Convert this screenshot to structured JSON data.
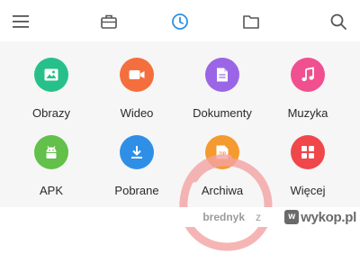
{
  "toolbar": {
    "items": [
      {
        "icon": "hamburger-menu-icon",
        "active": false
      },
      {
        "icon": "briefcase-icon",
        "active": false
      },
      {
        "icon": "clock-icon",
        "active": true
      },
      {
        "icon": "folder-icon",
        "active": false
      },
      {
        "icon": "search-icon",
        "active": false
      }
    ],
    "active_color": "#2f8fe6",
    "inactive_color": "#555555"
  },
  "categories": [
    {
      "label": "Obrazy",
      "icon": "image-icon",
      "color": "#27c08a"
    },
    {
      "label": "Wideo",
      "icon": "video-icon",
      "color": "#f46f3d"
    },
    {
      "label": "Dokumenty",
      "icon": "document-icon",
      "color": "#9a66e6"
    },
    {
      "label": "Muzyka",
      "icon": "music-icon",
      "color": "#f0508f"
    },
    {
      "label": "APK",
      "icon": "android-icon",
      "color": "#62c04b"
    },
    {
      "label": "Pobrane",
      "icon": "download-icon",
      "color": "#2f8fe6"
    },
    {
      "label": "Archiwa",
      "icon": "zip-icon",
      "color": "#f59a2e",
      "icon_text": "ZIP"
    },
    {
      "label": "Więcej",
      "icon": "grid-icon",
      "color": "#f0474b"
    }
  ],
  "annotation": {
    "color": "#f4a3a3"
  },
  "watermark": {
    "user": "brednyk",
    "z": "z",
    "logo_mark": "w",
    "logo_text": "wykop.pl"
  }
}
